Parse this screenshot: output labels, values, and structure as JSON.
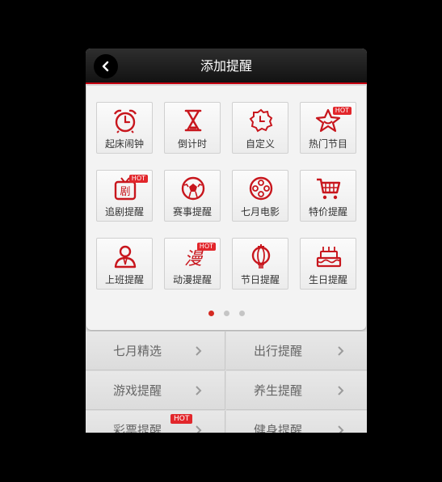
{
  "header": {
    "title": "添加提醒"
  },
  "grid": [
    {
      "label": "起床闹钟",
      "icon": "alarm-clock-icon"
    },
    {
      "label": "倒计时",
      "icon": "hourglass-icon"
    },
    {
      "label": "自定义",
      "icon": "custom-clock-icon"
    },
    {
      "label": "热门节目",
      "icon": "star-icon",
      "hot": "HOT"
    },
    {
      "label": "追剧提醒",
      "icon": "tv-drama-icon",
      "hot": "HOT",
      "glyph": "剧"
    },
    {
      "label": "赛事提醒",
      "icon": "soccer-ball-icon"
    },
    {
      "label": "七月电影",
      "icon": "film-reel-icon"
    },
    {
      "label": "特价提醒",
      "icon": "shopping-cart-icon"
    },
    {
      "label": "上班提醒",
      "icon": "worker-icon"
    },
    {
      "label": "动漫提醒",
      "icon": "anime-icon",
      "hot": "HOT",
      "glyph": "漫"
    },
    {
      "label": "节日提醒",
      "icon": "lantern-icon"
    },
    {
      "label": "生日提醒",
      "icon": "birthday-cake-icon"
    }
  ],
  "pager": {
    "pages": 3,
    "active": 0
  },
  "menu": [
    {
      "label": "七月精选"
    },
    {
      "label": "出行提醒"
    },
    {
      "label": "游戏提醒"
    },
    {
      "label": "养生提醒"
    },
    {
      "label": "彩票提醒",
      "hot": "HOT"
    },
    {
      "label": "健身提醒"
    }
  ],
  "colors": {
    "accent": "#c40010",
    "icon": "#c8161d",
    "hot": "#e2262b"
  }
}
